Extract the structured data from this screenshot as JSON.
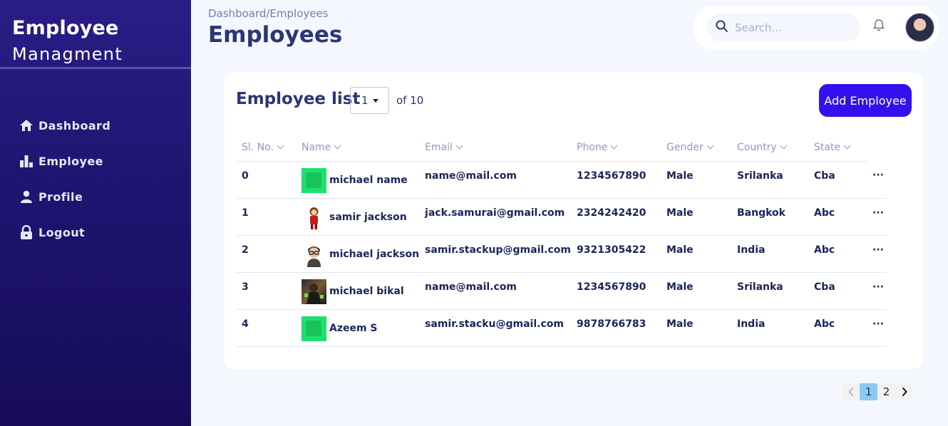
{
  "sidebar": {
    "brand_line1": "Employee",
    "brand_line2": "Managment",
    "items": [
      {
        "label": "Dashboard",
        "icon": "home-icon"
      },
      {
        "label": "Employee",
        "icon": "bar-chart-icon"
      },
      {
        "label": "Profile",
        "icon": "person-icon"
      },
      {
        "label": "Logout",
        "icon": "lock-icon"
      }
    ]
  },
  "header": {
    "breadcrumb": "Dashboard/Employees",
    "title": "Employees",
    "search_placeholder": "Search..."
  },
  "card": {
    "title": "Employee list",
    "page_select": "1",
    "of_text": "of 10",
    "add_button": "Add Employee"
  },
  "table": {
    "columns": [
      "Sl. No.",
      "Name",
      "Email",
      "Phone",
      "Gender",
      "Country",
      "State"
    ],
    "rows": [
      {
        "sl": "0",
        "name": "michael name",
        "email": "name@mail.com",
        "phone": "1234567890",
        "gender": "Male",
        "country": "Srilanka",
        "state": "Cba",
        "avatar": "green"
      },
      {
        "sl": "1",
        "name": "samir jackson",
        "email": "jack.samurai@gmail.com",
        "phone": "2324242420",
        "gender": "Male",
        "country": "Bangkok",
        "state": "Abc",
        "avatar": "red"
      },
      {
        "sl": "2",
        "name": "michael jackson",
        "email": "samir.stackup@gmail.com",
        "phone": "9321305422",
        "gender": "Male",
        "country": "India",
        "state": "Abc",
        "avatar": "glasses"
      },
      {
        "sl": "3",
        "name": "michael bikal",
        "email": "name@mail.com",
        "phone": "1234567890",
        "gender": "Male",
        "country": "Srilanka",
        "state": "Cba",
        "avatar": "dark"
      },
      {
        "sl": "4",
        "name": "Azeem S",
        "email": "samir.stacku@gmail.com",
        "phone": "9878766783",
        "gender": "Male",
        "country": "India",
        "state": "Abc",
        "avatar": "green"
      }
    ],
    "more_label": "···"
  },
  "pagination": {
    "pages": [
      "1",
      "2"
    ],
    "current": "1"
  },
  "colors": {
    "sidebar_top": "#2a1d86",
    "sidebar_bottom": "#160c58",
    "accent": "#3311ee",
    "text_dark": "#2b3674",
    "background": "#f4f7fe"
  }
}
